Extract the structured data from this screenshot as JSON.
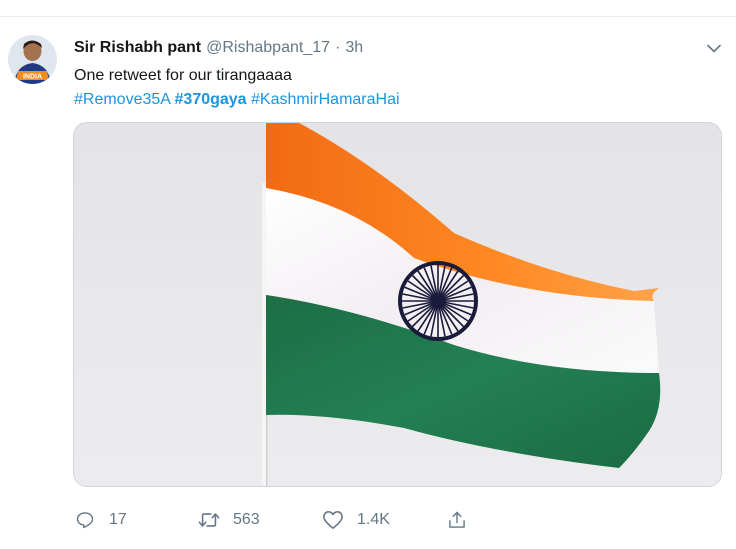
{
  "tweet": {
    "author_name": "Sir Rishabh pant",
    "handle": "@Rishabpant_17",
    "separator": "·",
    "time": "3h",
    "text": "One retweet for our tirangaaaa",
    "hashtags": [
      "#Remove35A",
      "#370gaya",
      "#KashmirHamaraHai"
    ],
    "avatar": {
      "jersey_text": "INDIA"
    },
    "media": {
      "subject": "indian-flag-image"
    },
    "actions": {
      "reply_count": "17",
      "retweet_count": "563",
      "like_count": "1.4K"
    }
  },
  "colors": {
    "link": "#1b95e0",
    "secondary_text": "#657786",
    "saffron": "#ff7a1a",
    "green": "#1f7a4f",
    "chakra": "#1a1a3a"
  },
  "icons": [
    "chevron-down-icon",
    "reply-icon",
    "retweet-icon",
    "like-icon",
    "share-icon"
  ]
}
